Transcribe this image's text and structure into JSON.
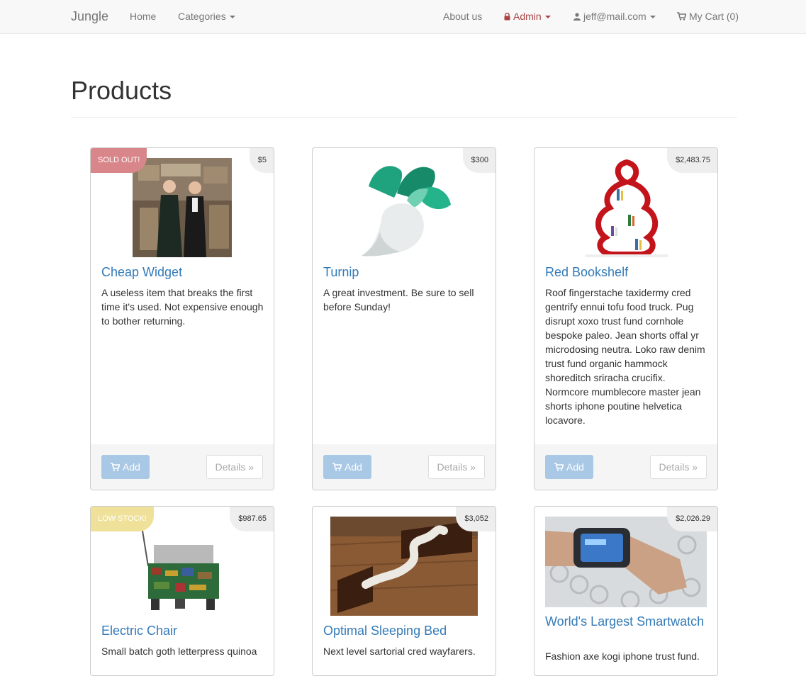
{
  "navbar": {
    "brand": "Jungle",
    "home": "Home",
    "categories": "Categories",
    "about": "About us",
    "admin": "Admin",
    "user": "jeff@mail.com",
    "cart": "My Cart (0)"
  },
  "page": {
    "title": "Products"
  },
  "colors": {
    "link": "#337ab7",
    "admin": "#a94442",
    "sold_out": "#d9868a",
    "low_stock": "#efe19a",
    "add_button": "#a9c8e6"
  },
  "products": [
    {
      "name": "Cheap Widget",
      "price": "$5",
      "status": "SOLD OUT!",
      "description": "A useless item that breaks the first time it's used. Not expensive enough to bother returning.",
      "add_label": "Add",
      "details_label": "Details »"
    },
    {
      "name": "Turnip",
      "price": "$300",
      "status": "",
      "description": "A great investment. Be sure to sell before Sunday!",
      "add_label": "Add",
      "details_label": "Details »"
    },
    {
      "name": "Red Bookshelf",
      "price": "$2,483.75",
      "status": "",
      "description": "Roof fingerstache taxidermy cred gentrify ennui tofu food truck. Pug disrupt xoxo trust fund cornhole bespoke paleo. Jean shorts offal yr microdosing neutra. Loko raw denim trust fund organic hammock shoreditch sriracha crucifix. Normcore mumblecore master jean shorts iphone poutine helvetica locavore.",
      "add_label": "Add",
      "details_label": "Details »"
    },
    {
      "name": "Electric Chair",
      "price": "$987.65",
      "status": "LOW STOCK!",
      "description": "Small batch goth letterpress quinoa"
    },
    {
      "name": "Optimal Sleeping Bed",
      "price": "$3,052",
      "status": "",
      "description": "Next level sartorial cred wayfarers."
    },
    {
      "name": "World's Largest Smartwatch",
      "price": "$2,026.29",
      "status": "",
      "description": "Fashion axe kogi iphone trust fund."
    }
  ]
}
